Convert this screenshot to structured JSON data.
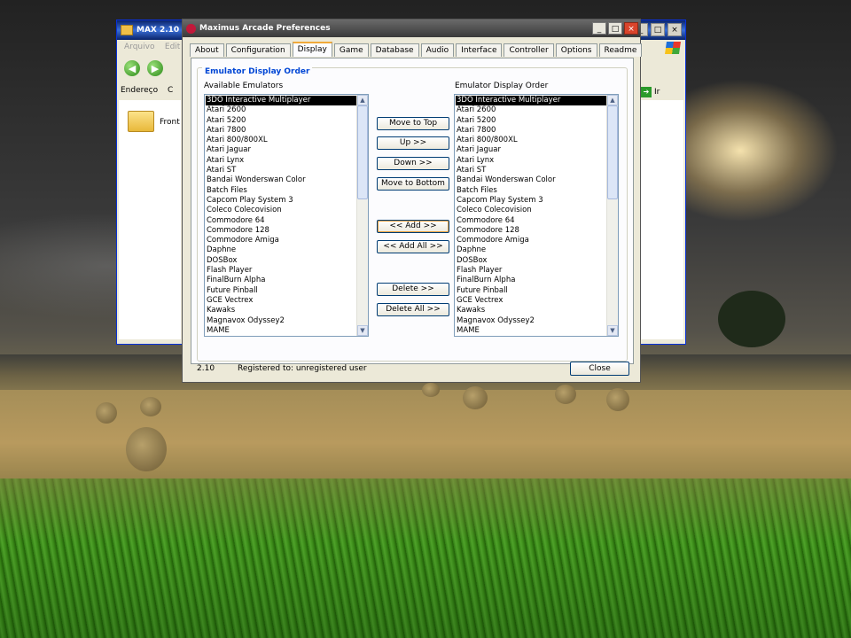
{
  "background_window": {
    "title": "MAX 2.10",
    "menu_items": [
      "Arquivo",
      "Edit"
    ],
    "address_label": "Endereço",
    "address_value": "C",
    "go_label": "Ir",
    "folder_label": "Front",
    "title_controls": [
      "_",
      "□",
      "×"
    ]
  },
  "dialog": {
    "title": "Maximus Arcade Preferences",
    "title_controls": [
      "_",
      "□",
      "×"
    ],
    "tabs": [
      "About",
      "Configuration",
      "Display Order",
      "Game Lists",
      "Database",
      "Audio",
      "Interface",
      "Controller",
      "Options",
      "Readme"
    ],
    "active_tab": "Display Order",
    "group_title": "Emulator Display Order",
    "available_label": "Available Emulators",
    "order_label": "Emulator Display Order",
    "available_items": [
      "3DO Interactive Multiplayer",
      "Atari 2600",
      "Atari 5200",
      "Atari 7800",
      "Atari 800/800XL",
      "Atari Jaguar",
      "Atari Lynx",
      "Atari ST",
      "Bandai Wonderswan Color",
      "Batch Files",
      "Capcom Play System 3",
      "Coleco Colecovision",
      "Commodore 64",
      "Commodore 128",
      "Commodore Amiga",
      "Daphne",
      "DOSBox",
      "Flash Player",
      "FinalBurn Alpha",
      "Future Pinball",
      "GCE Vectrex",
      "Kawaks",
      "Magnavox Odyssey2",
      "MAME"
    ],
    "order_items": [
      "3DO Interactive Multiplayer",
      "Atari 2600",
      "Atari 5200",
      "Atari 7800",
      "Atari 800/800XL",
      "Atari Jaguar",
      "Atari Lynx",
      "Atari ST",
      "Bandai Wonderswan Color",
      "Batch Files",
      "Capcom Play System 3",
      "Coleco Colecovision",
      "Commodore 64",
      "Commodore 128",
      "Commodore Amiga",
      "Daphne",
      "DOSBox",
      "Flash Player",
      "FinalBurn Alpha",
      "Future Pinball",
      "GCE Vectrex",
      "Kawaks",
      "Magnavox Odyssey2",
      "MAME"
    ],
    "buttons": {
      "move_top": "Move to Top",
      "up": "Up >>",
      "down": "Down >>",
      "move_bottom": "Move to Bottom",
      "add": "<< Add >>",
      "add_all": "<< Add All >>",
      "delete": "Delete >>",
      "delete_all": "Delete All >>"
    },
    "version": "2.10",
    "registration": "Registered to: unregistered user",
    "close_label": "Close"
  },
  "colors": {
    "selection": "#000000",
    "group_title": "#0046d5",
    "close_button": "#d9442b"
  }
}
